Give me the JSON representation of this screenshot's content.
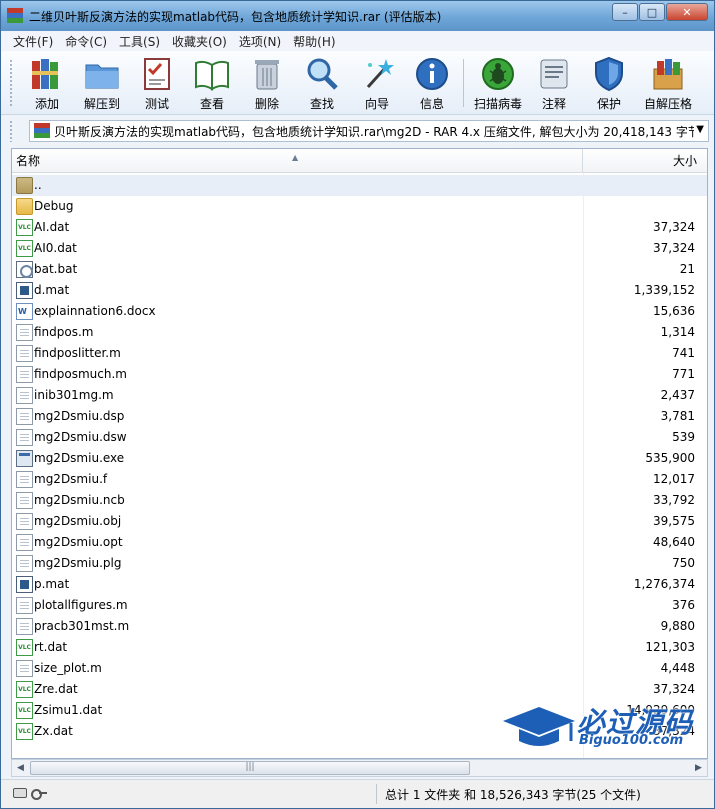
{
  "window": {
    "title": "二维贝叶斯反演方法的实现matlab代码，包含地质统计学知识.rar (评估版本)",
    "controls": {
      "minimize": "–",
      "maximize": "□",
      "close": "✕"
    }
  },
  "menu": [
    "文件(F)",
    "命令(C)",
    "工具(S)",
    "收藏夹(O)",
    "选项(N)",
    "帮助(H)"
  ],
  "toolbar": {
    "add": "添加",
    "extract_to": "解压到",
    "test": "测试",
    "view": "查看",
    "delete": "删除",
    "find": "查找",
    "wizard": "向导",
    "info": "信息",
    "scan": "扫描病毒",
    "comment": "注释",
    "protect": "保护",
    "sfx": "自解压格"
  },
  "address": {
    "path": "贝叶斯反演方法的实现matlab代码，包含地质统计学知识.rar\\mg2D - RAR 4.x 压缩文件, 解包大小为 20,418,143 字节"
  },
  "list": {
    "col_name": "名称",
    "col_size": "大小",
    "files": [
      {
        "name": "..",
        "size": "",
        "icon": "up"
      },
      {
        "name": "Debug",
        "size": "",
        "icon": "folder"
      },
      {
        "name": "AI.dat",
        "size": "37,324",
        "icon": "vlc"
      },
      {
        "name": "AI0.dat",
        "size": "37,324",
        "icon": "vlc"
      },
      {
        "name": "bat.bat",
        "size": "21",
        "icon": "bat"
      },
      {
        "name": "d.mat",
        "size": "1,339,152",
        "icon": "mat"
      },
      {
        "name": "explainnation6.docx",
        "size": "15,636",
        "icon": "word"
      },
      {
        "name": "findpos.m",
        "size": "1,314",
        "icon": "doc"
      },
      {
        "name": "findposlitter.m",
        "size": "741",
        "icon": "doc"
      },
      {
        "name": "findposmuch.m",
        "size": "771",
        "icon": "doc"
      },
      {
        "name": "inib301mg.m",
        "size": "2,437",
        "icon": "doc"
      },
      {
        "name": "mg2Dsmiu.dsp",
        "size": "3,781",
        "icon": "doc"
      },
      {
        "name": "mg2Dsmiu.dsw",
        "size": "539",
        "icon": "doc"
      },
      {
        "name": "mg2Dsmiu.exe",
        "size": "535,900",
        "icon": "exe"
      },
      {
        "name": "mg2Dsmiu.f",
        "size": "12,017",
        "icon": "doc"
      },
      {
        "name": "mg2Dsmiu.ncb",
        "size": "33,792",
        "icon": "doc"
      },
      {
        "name": "mg2Dsmiu.obj",
        "size": "39,575",
        "icon": "doc"
      },
      {
        "name": "mg2Dsmiu.opt",
        "size": "48,640",
        "icon": "doc"
      },
      {
        "name": "mg2Dsmiu.plg",
        "size": "750",
        "icon": "doc"
      },
      {
        "name": "p.mat",
        "size": "1,276,374",
        "icon": "mat"
      },
      {
        "name": "plotallfigures.m",
        "size": "376",
        "icon": "doc"
      },
      {
        "name": "pracb301mst.m",
        "size": "9,880",
        "icon": "doc"
      },
      {
        "name": "rt.dat",
        "size": "121,303",
        "icon": "vlc"
      },
      {
        "name": "size_plot.m",
        "size": "4,448",
        "icon": "doc"
      },
      {
        "name": "Zre.dat",
        "size": "37,324",
        "icon": "vlc"
      },
      {
        "name": "Zsimu1.dat",
        "size": "14,929,600",
        "icon": "vlc"
      },
      {
        "name": "Zx.dat",
        "size": "37,324",
        "icon": "vlc"
      }
    ]
  },
  "status": {
    "text": "总计 1 文件夹 和 18,526,343 字节(25 个文件)"
  },
  "watermark": {
    "main": "必过源码",
    "sub": "Biguo100.com"
  }
}
